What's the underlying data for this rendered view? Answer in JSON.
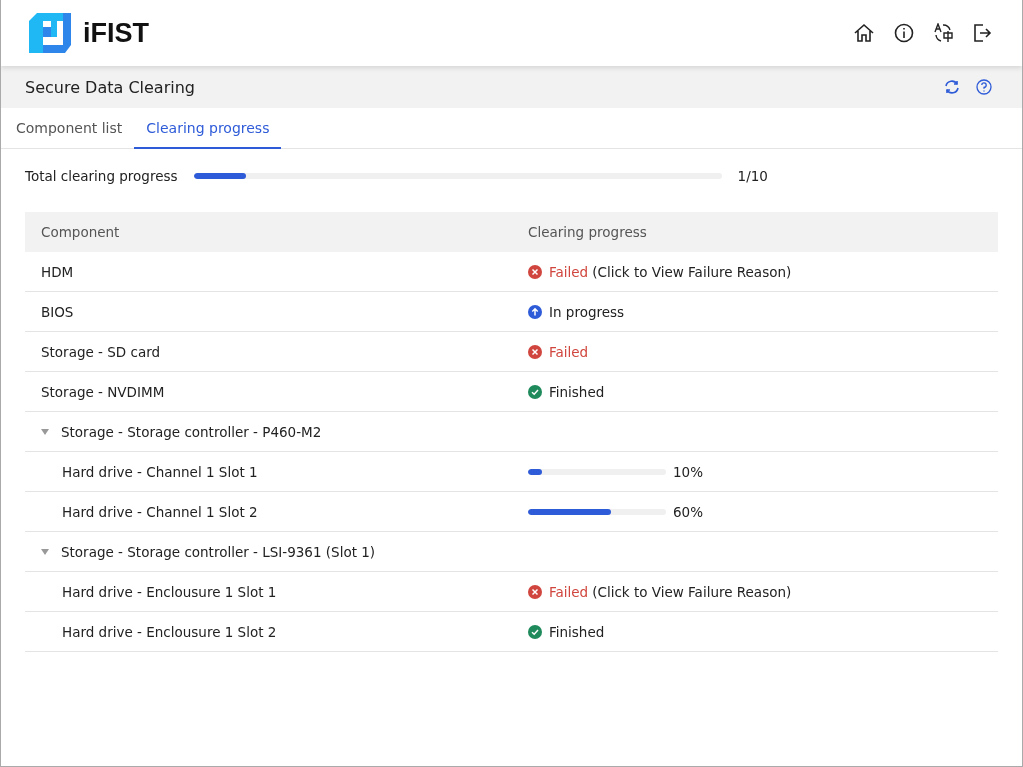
{
  "header": {
    "logo_text": "iFIST"
  },
  "page_title": "Secure Data Clearing",
  "tabs": [
    {
      "label": "Component list",
      "selected": false
    },
    {
      "label": "Clearing progress",
      "selected": true
    }
  ],
  "total_progress": {
    "label": "Total clearing progress",
    "level": 0.1,
    "reading": "1/10"
  },
  "table": {
    "columns": [
      "Component",
      "Clearing progress"
    ],
    "rows": [
      {
        "component": "HDM",
        "status": {
          "kind": "failed",
          "label": "Failed",
          "link": "(Click to View Failure Reason)"
        }
      },
      {
        "component": "BIOS",
        "status": {
          "kind": "in_progress",
          "label": "In progress"
        }
      },
      {
        "component": "Storage - SD card",
        "status": {
          "kind": "failed",
          "label": "Failed"
        }
      },
      {
        "component": "Storage - NVDIMM",
        "status": {
          "kind": "finished",
          "label": "Finished"
        }
      },
      {
        "component": "Storage - Storage controller - P460-M2",
        "expanded": true,
        "children": [
          {
            "component": "Hard drive - Channel 1 Slot 1",
            "status": {
              "kind": "bar",
              "level": 0.1,
              "reading": "10%"
            }
          },
          {
            "component": "Hard drive - Channel 1 Slot 2",
            "status": {
              "kind": "bar",
              "level": 0.6,
              "reading": "60%"
            }
          }
        ]
      },
      {
        "component": "Storage - Storage controller - LSI-9361 (Slot 1)",
        "expanded": true,
        "children": [
          {
            "component": "Hard drive - Enclousure 1 Slot 1",
            "status": {
              "kind": "failed",
              "label": "Failed",
              "link": "(Click to View Failure Reason)"
            }
          },
          {
            "component": "Hard drive - Enclousure 1 Slot 2",
            "status": {
              "kind": "finished",
              "label": "Finished"
            }
          }
        ]
      }
    ]
  }
}
